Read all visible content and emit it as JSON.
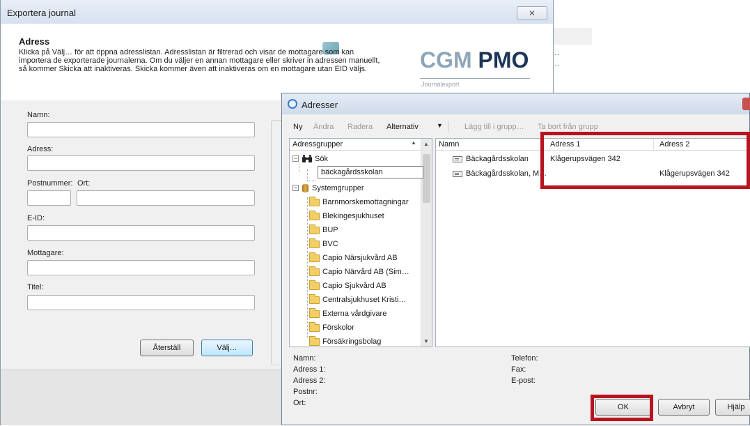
{
  "export_window": {
    "title": "Exportera journal",
    "close_glyph": "✕",
    "heading": "Adress",
    "description": "Klicka på Välj… för att öppna adresslistan. Adresslistan är filtrerad och visar de mottagare som kan importera de exporterade journalerna. Om du väljer en annan mottagare eller skriver in adressen manuellt, så kommer Skicka att inaktiveras. Skicka kommer även att inaktiveras om en mottagare utan EID väljs.",
    "logo_cgm": "CGM",
    "logo_pmo": "PMO",
    "logo_sub": "Journalexport",
    "fields": {
      "name_label": "Namn:",
      "address_label": "Adress:",
      "postal_label": "Postnummer:",
      "city_label": "Ort:",
      "eid_label": "E-ID:",
      "recipient_label": "Mottagare:",
      "title_label": "Titel:"
    },
    "reset_button": "Återställ",
    "choose_button": "Välj…"
  },
  "background": {
    "dots1": "…",
    "dots2": "…"
  },
  "addresses_dialog": {
    "title": "Adresser",
    "toolbar": {
      "new": "Ny",
      "edit": "Ändra",
      "delete": "Radera",
      "options": "Alternativ",
      "add_to_group": "Lägg till i grupp…",
      "remove_from_group": "Ta bort från grupp"
    },
    "tree": {
      "header": "Adressgrupper",
      "search_node": "Sök",
      "search_value": "bäckagårdsskolan",
      "system_groups": "Systemgrupper",
      "groups": [
        "Barnmorskemottagningar",
        "Blekingesjukhuset",
        "BUP",
        "BVC",
        "Capio Närsjukvård AB",
        "Capio Närvård AB (Sim…",
        "Capio Sjukvård AB",
        "Centralsjukhuset Kristi…",
        "Externa vårdgivare",
        "Förskolor",
        "Försäkringsbolag"
      ]
    },
    "list": {
      "columns": [
        "Namn",
        "Adress 1",
        "Adress 2"
      ],
      "rows": [
        {
          "name": "Bäckagårdsskolan",
          "address1": "Klågerupsvägen 342",
          "address2": ""
        },
        {
          "name": "Bäckagårdsskolan, M…",
          "address1": "",
          "address2": "Klågerupsvägen 342"
        }
      ]
    },
    "details": {
      "name": "Namn:",
      "address1": "Adress 1:",
      "address2": "Adress 2:",
      "postal": "Postnr:",
      "city": "Ort:",
      "phone": "Telefon:",
      "fax": "Fax:",
      "email": "E-post:"
    },
    "ok_button": "OK",
    "cancel_button": "Avbryt",
    "help_button": "Hjälp"
  },
  "colors": {
    "highlight_red": "#b8141f",
    "logo_navy": "#1d3559",
    "logo_grey": "#8fa6b8"
  }
}
